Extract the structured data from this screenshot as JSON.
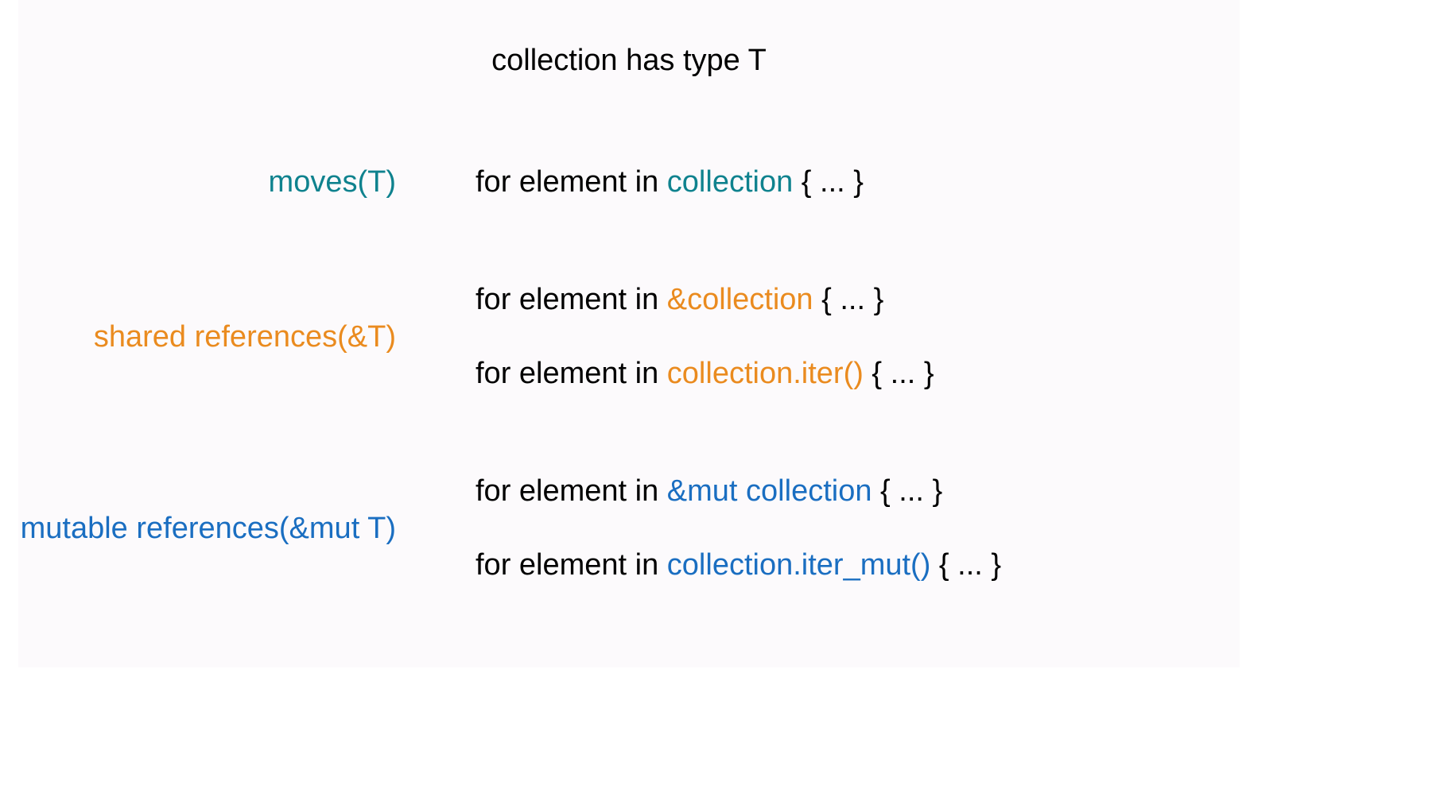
{
  "title": "collection has type T",
  "rows": [
    {
      "label": "moves(T)",
      "color": "teal",
      "lines": [
        {
          "prefix": "for element in ",
          "highlight": "collection",
          "suffix": " { ... }"
        }
      ]
    },
    {
      "label": "shared references(&T)",
      "color": "orange",
      "lines": [
        {
          "prefix": "for element in ",
          "highlight": "&collection",
          "suffix": " { ... }"
        },
        {
          "prefix": "for element in ",
          "highlight": "collection.iter()",
          "suffix": " { ... }"
        }
      ]
    },
    {
      "label": "mutable references(&mut T)",
      "color": "blue",
      "lines": [
        {
          "prefix": "for element in ",
          "highlight": "&mut collection",
          "suffix": " { ... }"
        },
        {
          "prefix": "for element in ",
          "highlight": "collection.iter_mut()",
          "suffix": " { ... }"
        }
      ]
    }
  ]
}
